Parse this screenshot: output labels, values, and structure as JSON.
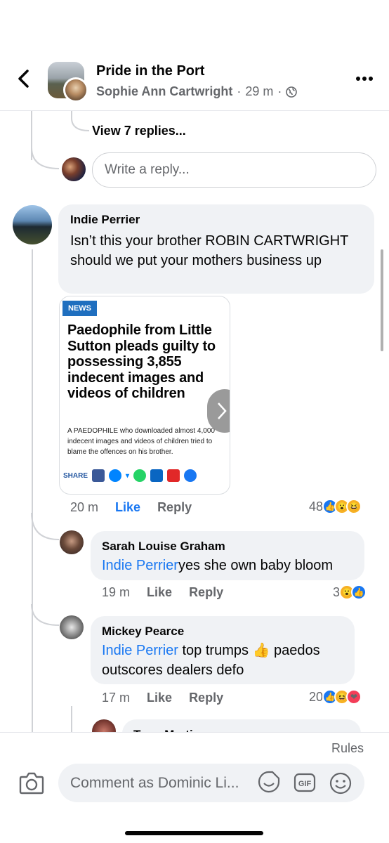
{
  "header": {
    "group_title": "Pride in the Port",
    "author": "Sophie Ann Cartwright",
    "time": "29 m",
    "separator": "·"
  },
  "thread": {
    "view_replies": "View 7 replies...",
    "reply_placeholder": "Write a reply..."
  },
  "comment_main": {
    "name": "Indie Perrier",
    "text": "Isn’t this your brother ROBIN CARTWRIGHT should we put your mothers business up",
    "time": "20 m",
    "like": "Like",
    "reply": "Reply",
    "reaction_count": "48",
    "link_card": {
      "tag": "NEWS",
      "headline": "Paedophile from Little Sutton pleads guilty to possessing 3,855 indecent images and videos of children",
      "summary": "A PAEDOPHILE who downloaded almost 4,000 indecent images and videos of children tried to blame the offences on his brother.",
      "share_label": "SHARE"
    }
  },
  "reply_1": {
    "name": "Sarah Louise Graham",
    "mention": "Indie Perrier",
    "text": "yes she own baby bloom",
    "time": "19 m",
    "like": "Like",
    "reply": "Reply",
    "reaction_count": "3"
  },
  "reply_2": {
    "name": "Mickey Pearce",
    "mention": "Indie Perrier",
    "text_a": " top trumps ",
    "emoji": "👍",
    "text_b": " paedos outscores dealers defo",
    "time": "17 m",
    "like": "Like",
    "reply": "Reply",
    "reaction_count": "20"
  },
  "reply_3_partial_name": "Tony Martin",
  "footer": {
    "rules": "Rules",
    "composer_placeholder": "Comment as Dominic Li..."
  },
  "colors": {
    "accent": "#1877f2",
    "bubble": "#f0f2f5",
    "muted": "#65676b"
  }
}
